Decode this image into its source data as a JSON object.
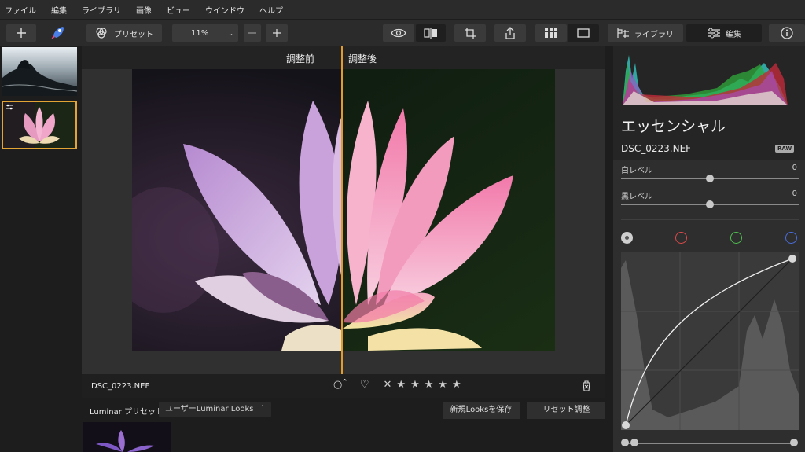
{
  "menu": [
    "ファイル",
    "編集",
    "ライブラリ",
    "画像",
    "ビュー",
    "ウインドウ",
    "ヘルプ"
  ],
  "toolbar": {
    "preset_label": "プリセット",
    "zoom": "11%",
    "library_label": "ライブラリ",
    "edit_label": "編集"
  },
  "viewer": {
    "before_label": "調整前",
    "after_label": "調整後"
  },
  "info": {
    "filename": "DSC_0223.NEF"
  },
  "presets": {
    "title": "Luminar プリセット",
    "category": "ユーザーLuminar Looks",
    "save_button": "新規Looksを保存",
    "reset_button": "リセット調整"
  },
  "panel": {
    "title": "エッセンシャル",
    "filename": "DSC_0223.NEF",
    "badge": "RAW",
    "white_label": "白レベル",
    "white_value": "0",
    "black_label": "黒レベル",
    "black_value": "0"
  },
  "colors": {
    "accent": "#e2a535",
    "red_channel": "#e04a4a",
    "green_channel": "#4fbf4f",
    "blue_channel": "#4a6ee0"
  }
}
